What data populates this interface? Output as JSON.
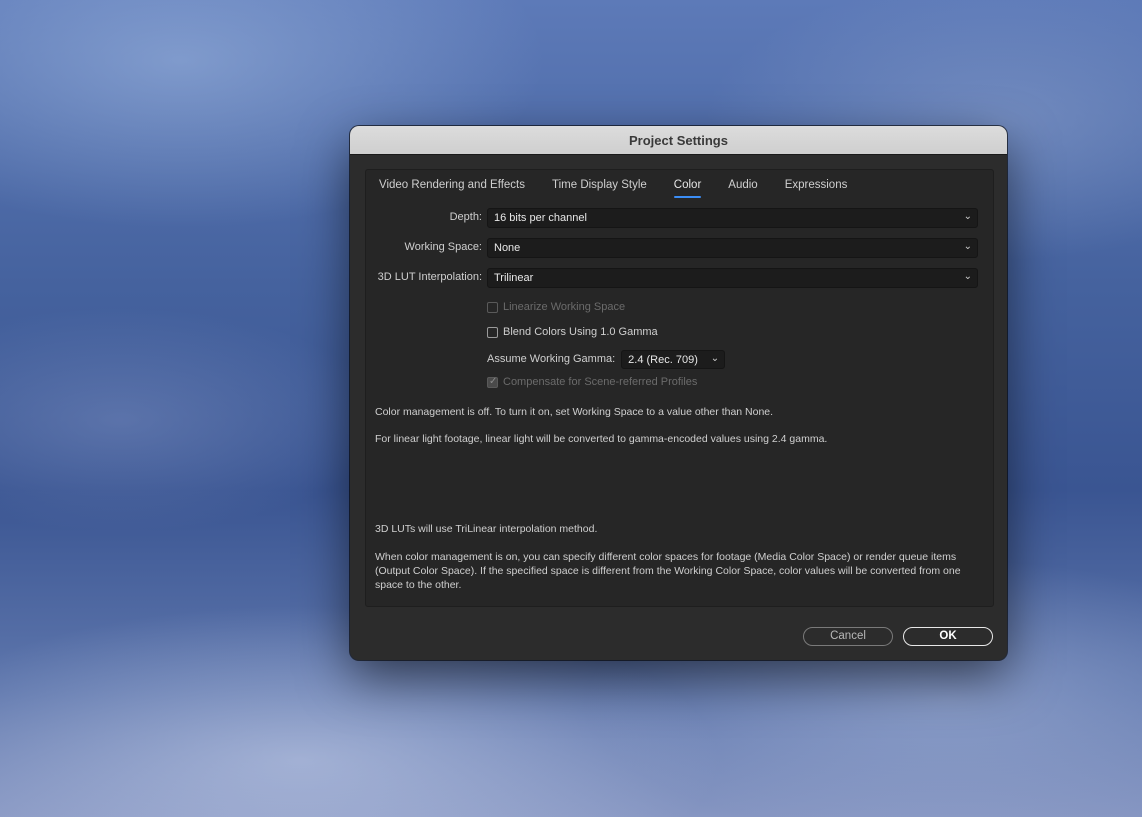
{
  "dialog": {
    "title": "Project Settings",
    "tabs": [
      {
        "label": "Video Rendering and Effects"
      },
      {
        "label": "Time Display Style"
      },
      {
        "label": "Color"
      },
      {
        "label": "Audio"
      },
      {
        "label": "Expressions"
      }
    ],
    "active_tab": "Color",
    "depth": {
      "label": "Depth:",
      "value": "16 bits per channel"
    },
    "working_space": {
      "label": "Working Space:",
      "value": "None"
    },
    "lut": {
      "label": "3D LUT Interpolation:",
      "value": "Trilinear"
    },
    "linearize": {
      "label": "Linearize Working Space",
      "checked": false,
      "enabled": false
    },
    "blend": {
      "label": "Blend Colors Using 1.0 Gamma",
      "checked": false,
      "enabled": true
    },
    "gamma": {
      "label": "Assume Working Gamma:",
      "value": "2.4 (Rec. 709)"
    },
    "compensate": {
      "label": "Compensate for Scene-referred Profiles",
      "checked": true,
      "enabled": false
    },
    "notes": [
      "Color management is off. To turn it on, set Working Space to a value other than None.",
      "For linear light footage, linear light will be converted to gamma-encoded values using 2.4 gamma.",
      "3D LUTs will use TriLinear interpolation method.",
      "When color management is on, you can specify different color spaces for footage (Media Color Space) or render queue items (Output Color Space). If the specified space is different from the Working Color Space, color values will be converted from one space to the other."
    ],
    "cancel_label": "Cancel",
    "ok_label": "OK"
  },
  "colors": {
    "accent": "#3b8df5",
    "dialog_bg": "#2c2c2c",
    "titlebar_bg": "#d6d6d6"
  }
}
